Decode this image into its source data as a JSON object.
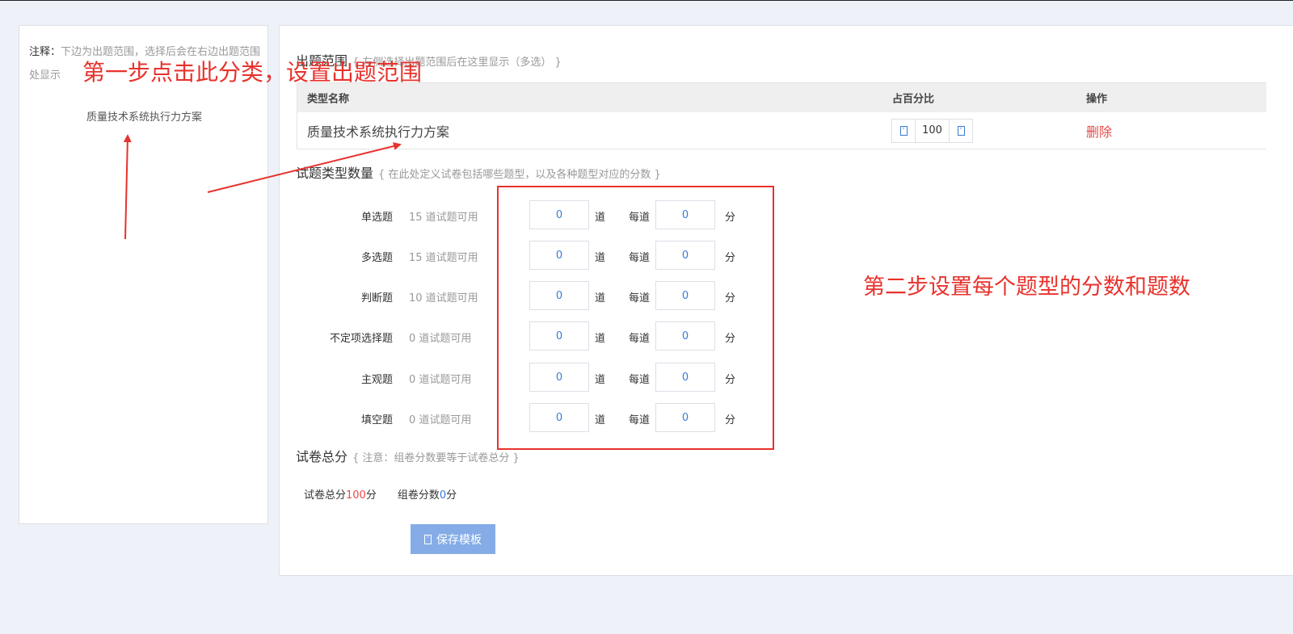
{
  "sidebar": {
    "note_label": "注释：",
    "note_text": "下边为出题范围，选择后会在右边出题范围处显示",
    "categories": [
      "质量技术系统执行力方案"
    ]
  },
  "range": {
    "title": "出题范围",
    "hint": "{ 左侧选择出题范围后在这里显示（多选） }",
    "columns": [
      "类型名称",
      "占百分比",
      "操作"
    ],
    "rows": [
      {
        "name": "质量技术系统执行力方案",
        "percent": "100",
        "action": "删除"
      }
    ]
  },
  "types": {
    "title": "试题类型数量",
    "hint": "{ 在此处定义试卷包括哪些题型，以及各种题型对应的分数 }",
    "unit_count": "道",
    "unit_each": "每道",
    "unit_score": "分",
    "rows": [
      {
        "type": "单选题",
        "available": "15 道试题可用",
        "count": "0",
        "score": "0"
      },
      {
        "type": "多选题",
        "available": "15 道试题可用",
        "count": "0",
        "score": "0"
      },
      {
        "type": "判断题",
        "available": "10 道试题可用",
        "count": "0",
        "score": "0"
      },
      {
        "type": "不定项选择题",
        "available": "0 道试题可用",
        "count": "0",
        "score": "0"
      },
      {
        "type": "主观题",
        "available": "0 道试题可用",
        "count": "0",
        "score": "0"
      },
      {
        "type": "填空题",
        "available": "0 道试题可用",
        "count": "0",
        "score": "0"
      }
    ]
  },
  "total": {
    "title": "试卷总分",
    "hint": "{ 注意：组卷分数要等于试卷总分 }",
    "paper_total_label": "试卷总分",
    "paper_total_value": "100",
    "paper_total_unit": "分",
    "assembled_label": "组卷分数",
    "assembled_value": "0",
    "assembled_unit": "分"
  },
  "save_label": "保存模板",
  "annotations": {
    "step1": "第一步点击此分类，设置出题范围",
    "step2": "第二步设置每个题型的分数和题数",
    "color": "#e8322c"
  },
  "colors": {
    "accent": "#3a7bd5",
    "danger": "#e64a4a",
    "button": "#85ace6"
  }
}
